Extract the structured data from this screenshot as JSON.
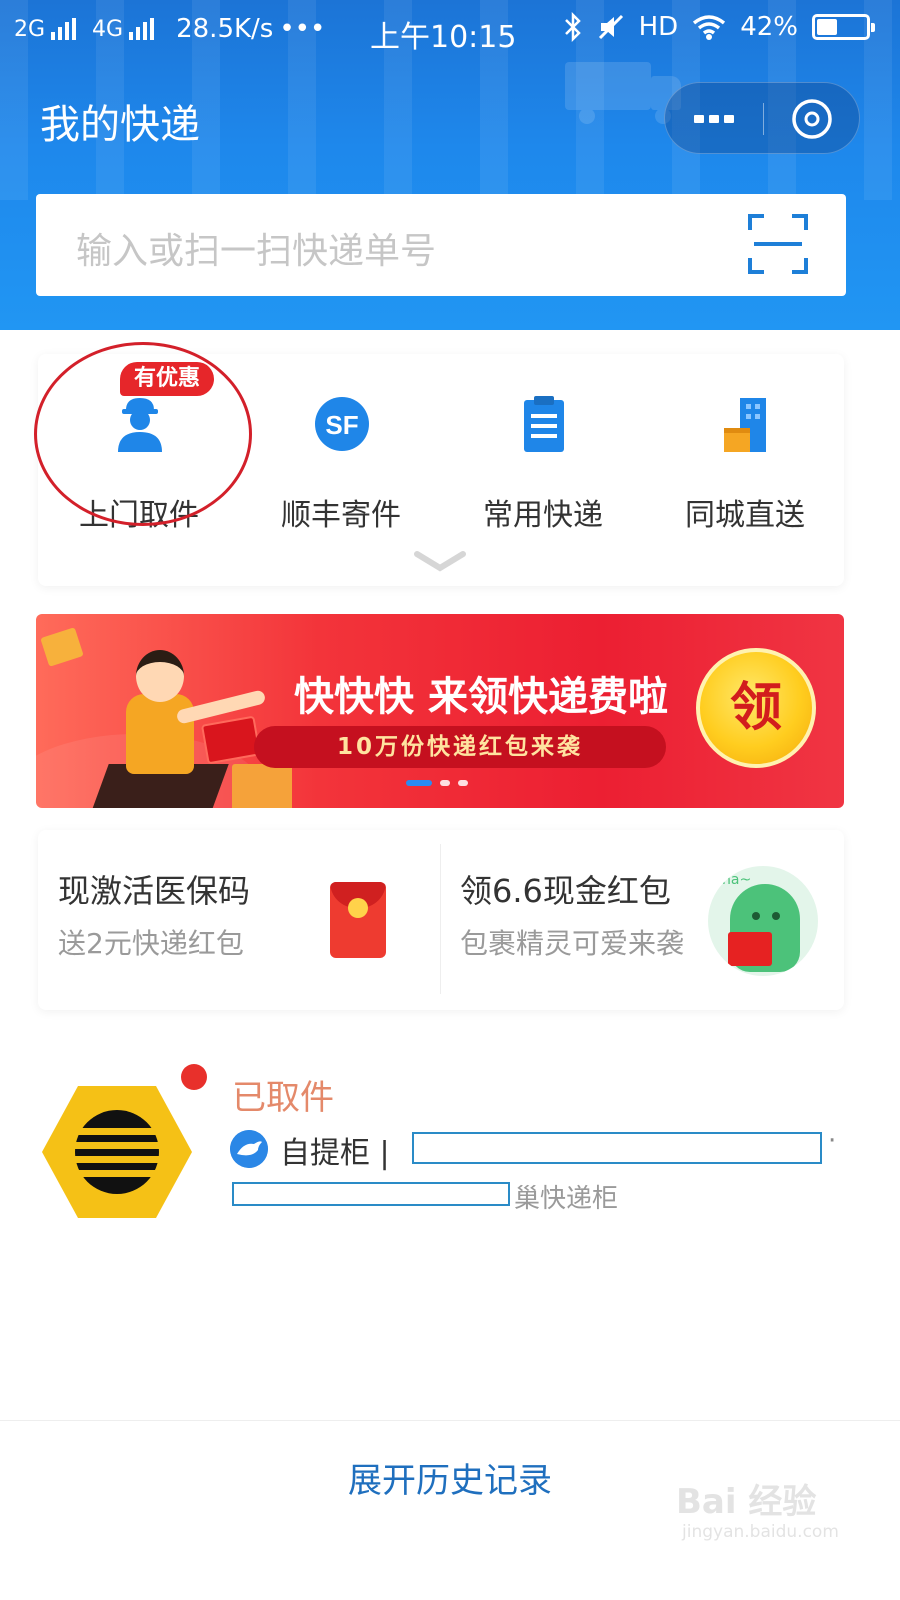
{
  "status_bar": {
    "network1": "2G",
    "network2": "4G",
    "speed": "28.5K/s",
    "more": "•••",
    "time": "上午10:15",
    "hd": "HD",
    "battery": "42%",
    "battery_level": 0.42
  },
  "header": {
    "title": "我的快递",
    "more_icon": "more-dots-icon",
    "close_icon": "close-target-icon"
  },
  "search": {
    "placeholder": "输入或扫一扫快递单号",
    "scan_icon": "scan-icon"
  },
  "shortcuts": {
    "badge": "有优惠",
    "items": [
      {
        "label": "上门取件",
        "icon": "courier-person-icon"
      },
      {
        "label": "顺丰寄件",
        "icon": "sf-logo-icon",
        "icon_text": "SF"
      },
      {
        "label": "常用快递",
        "icon": "clipboard-icon"
      },
      {
        "label": "同城直送",
        "icon": "city-building-icon"
      }
    ],
    "expand_icon": "chevron-down-icon"
  },
  "banner": {
    "headline": "快快快 来领快递费啦",
    "subline": "10万份快递红包来袭",
    "button": "领",
    "page_count": 3,
    "active_page": 1
  },
  "promos": [
    {
      "title": "现激活医保码",
      "subtitle": "送2元快递红包",
      "icon": "red-envelope-icon"
    },
    {
      "title": "领6.6现金红包",
      "subtitle": "包裹精灵可爱来袭",
      "icon": "mascot-icon",
      "icon_text": "na~"
    }
  ],
  "package": {
    "status": "已取件",
    "carrier_label": "自提柜 | ",
    "address_tail": "巢快递柜",
    "logo_icon": "hive-box-logo-icon",
    "carrier_icon": "carrier-bird-icon"
  },
  "footer": {
    "history_link": "展开历史记录"
  },
  "watermark": {
    "main": "Bai 经验",
    "sub": "jingyan.baidu.com"
  },
  "colors": {
    "header_blue": "#1e88ec",
    "badge_red": "#e6262a",
    "status_orange": "#e4896a",
    "link_blue": "#1f6fbe"
  }
}
